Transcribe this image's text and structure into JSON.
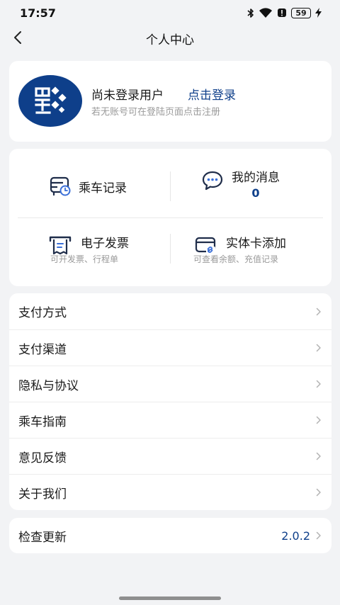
{
  "status_bar": {
    "time": "17:57",
    "battery": "59",
    "icons": [
      "bluetooth-icon",
      "wifi-icon",
      "alert-icon",
      "battery-icon",
      "charging-icon"
    ]
  },
  "header": {
    "title": "个人中心",
    "back_icon": "chevron-left-icon"
  },
  "profile": {
    "status": "尚未登录用户",
    "login_link": "点击登录",
    "hint": "若无账号可在登陆页面点击注册",
    "avatar_icon": "transit-logo-icon"
  },
  "features": {
    "ride_records": {
      "label": "乘车记录",
      "icon": "bus-clock-icon"
    },
    "messages": {
      "label": "我的消息",
      "count": "0",
      "icon": "chat-bubble-icon"
    },
    "invoice": {
      "label": "电子发票",
      "sub": "可开发票、行程单",
      "icon": "receipt-icon"
    },
    "card_add": {
      "label": "实体卡添加",
      "sub": "可查看余额、充值记录",
      "icon": "card-link-icon"
    }
  },
  "menu": {
    "items": [
      {
        "label": "支付方式"
      },
      {
        "label": "支付渠道"
      },
      {
        "label": "隐私与协议"
      },
      {
        "label": "乘车指南"
      },
      {
        "label": "意见反馈"
      },
      {
        "label": "关于我们"
      }
    ]
  },
  "update": {
    "label": "检查更新",
    "version": "2.0.2"
  },
  "colors": {
    "accent": "#0e3f8a",
    "background": "#f2f3f5",
    "card": "#ffffff",
    "muted_text": "#9a9a9a"
  }
}
